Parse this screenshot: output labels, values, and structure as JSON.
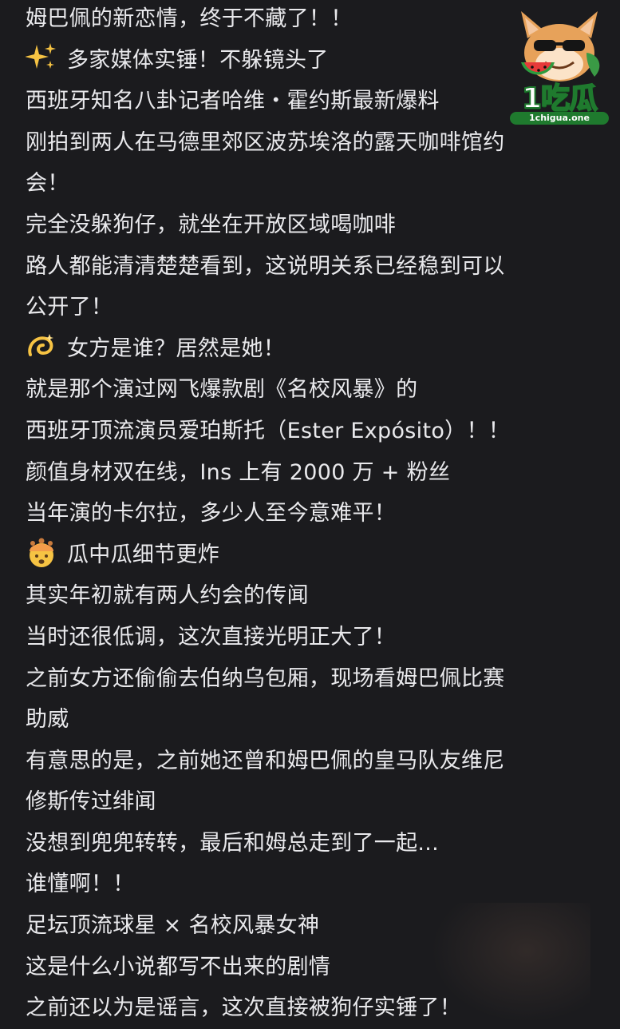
{
  "post": {
    "lines": [
      {
        "text": "姆巴佩的新恋情，终于不藏了！！",
        "icon": ""
      },
      {
        "text": "多家媒体实锤！不躲镜头了",
        "icon": "sparkles-icon"
      },
      {
        "text": "西班牙知名八卦记者哈维・霍约斯最新爆料",
        "icon": ""
      },
      {
        "text": "刚拍到两人在马德里郊区波苏埃洛的露天咖啡馆约",
        "icon": ""
      },
      {
        "text": "会！",
        "icon": ""
      },
      {
        "text": "完全没躲狗仔，就坐在开放区域喝咖啡",
        "icon": ""
      },
      {
        "text": "路人都能清清楚楚看到，这说明关系已经稳到可以",
        "icon": ""
      },
      {
        "text": "公开了！",
        "icon": ""
      },
      {
        "text": "女方是谁？居然是她！",
        "icon": "dizzy-icon"
      },
      {
        "text": "就是那个演过网飞爆款剧《名校风暴》的",
        "icon": ""
      },
      {
        "text": "西班牙顶流演员爱珀斯托（Ester Expósito）！！",
        "icon": ""
      },
      {
        "text": "颜值身材双在线，Ins 上有 2000 万 + 粉丝",
        "icon": ""
      },
      {
        "text": "当年演的卡尔拉，多少人至今意难平！",
        "icon": ""
      },
      {
        "text": "瓜中瓜细节更炸",
        "icon": "mind-blown-icon"
      },
      {
        "text": "其实年初就有两人约会的传闻",
        "icon": ""
      },
      {
        "text": "当时还很低调，这次直接光明正大了！",
        "icon": ""
      },
      {
        "text": "之前女方还偷偷去伯纳乌包厢，现场看姆巴佩比赛",
        "icon": ""
      },
      {
        "text": "助威",
        "icon": ""
      },
      {
        "text": "有意思的是，之前她还曾和姆巴佩的皇马队友维尼",
        "icon": ""
      },
      {
        "text": "修斯传过绯闻",
        "icon": ""
      },
      {
        "text": "没想到兜兜转转，最后和姆总走到了一起...",
        "icon": ""
      },
      {
        "text": "谁懂啊！！",
        "icon": ""
      },
      {
        "text": "足坛顶流球星 × 名校风暴女神",
        "icon": ""
      },
      {
        "text": "这是什么小说都写不出来的剧情",
        "icon": ""
      },
      {
        "text": "之前还以为是谣言，这次直接被狗仔实锤了！",
        "icon": ""
      }
    ]
  },
  "watermark": {
    "brand": "1吃瓜",
    "url": "1chigua.one"
  }
}
